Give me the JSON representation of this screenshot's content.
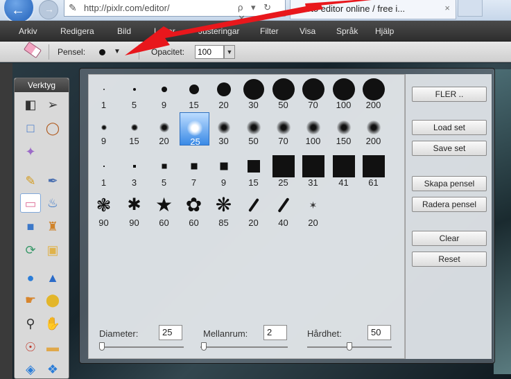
{
  "browser": {
    "url": "http://pixlr.com/editor/",
    "url_controls": "ρ ▾ ↻ ✕",
    "tab_title": "oto editor online / free i...",
    "tab_close": "×"
  },
  "menubar": {
    "items": [
      "Arkiv",
      "Redigera",
      "Bild",
      "Lager",
      "Justeringar",
      "Filter",
      "Visa",
      "Språk",
      "Hjälp"
    ]
  },
  "options": {
    "brush_label": "Pensel:",
    "opacity_label": "Opacitet:",
    "opacity_value": "100"
  },
  "toolbox": {
    "title": "Verktyg",
    "tool_icons": [
      "crop-icon",
      "move-icon",
      "marquee-icon",
      "lasso-icon",
      "wand-icon",
      "pencil-icon",
      "brush-icon",
      "eraser-icon",
      "bucket-icon",
      "gradient-icon",
      "stamp-icon",
      "replace-color-icon",
      "shape-icon",
      "drop-icon",
      "sharpen-icon",
      "smudge-icon",
      "sponge-icon",
      "zoom-icon",
      "hand-icon",
      "red-eye-icon",
      "bandage-icon",
      "spherize-icon",
      "pinch-icon"
    ]
  },
  "brushes": {
    "row1_hard": [
      "1",
      "5",
      "9",
      "15",
      "20",
      "30",
      "50",
      "70",
      "100",
      "200"
    ],
    "row2_soft": [
      "9",
      "15",
      "20",
      "25",
      "30",
      "50",
      "70",
      "100",
      "150",
      "200"
    ],
    "row3_square": [
      "1",
      "3",
      "5",
      "7",
      "9",
      "15",
      "25",
      "31",
      "41",
      "61"
    ],
    "row4_shapes": [
      "90",
      "90",
      "60",
      "60",
      "85",
      "20",
      "40",
      "20"
    ],
    "selected": "25"
  },
  "side_buttons": {
    "more": "FLER ..",
    "load_set": "Load set",
    "save_set": "Save set",
    "create_brush": "Skapa pensel",
    "delete_brush": "Radera pensel",
    "clear": "Clear",
    "reset": "Reset"
  },
  "params": {
    "diameter_label": "Diameter:",
    "diameter_value": "25",
    "spacing_label": "Mellanrum:",
    "spacing_value": "2",
    "hardness_label": "Hårdhet:",
    "hardness_value": "50"
  },
  "colors": {
    "annotation": "#e8171c",
    "selection": "#3a8ae6",
    "menubar": "#3a3a3a"
  }
}
